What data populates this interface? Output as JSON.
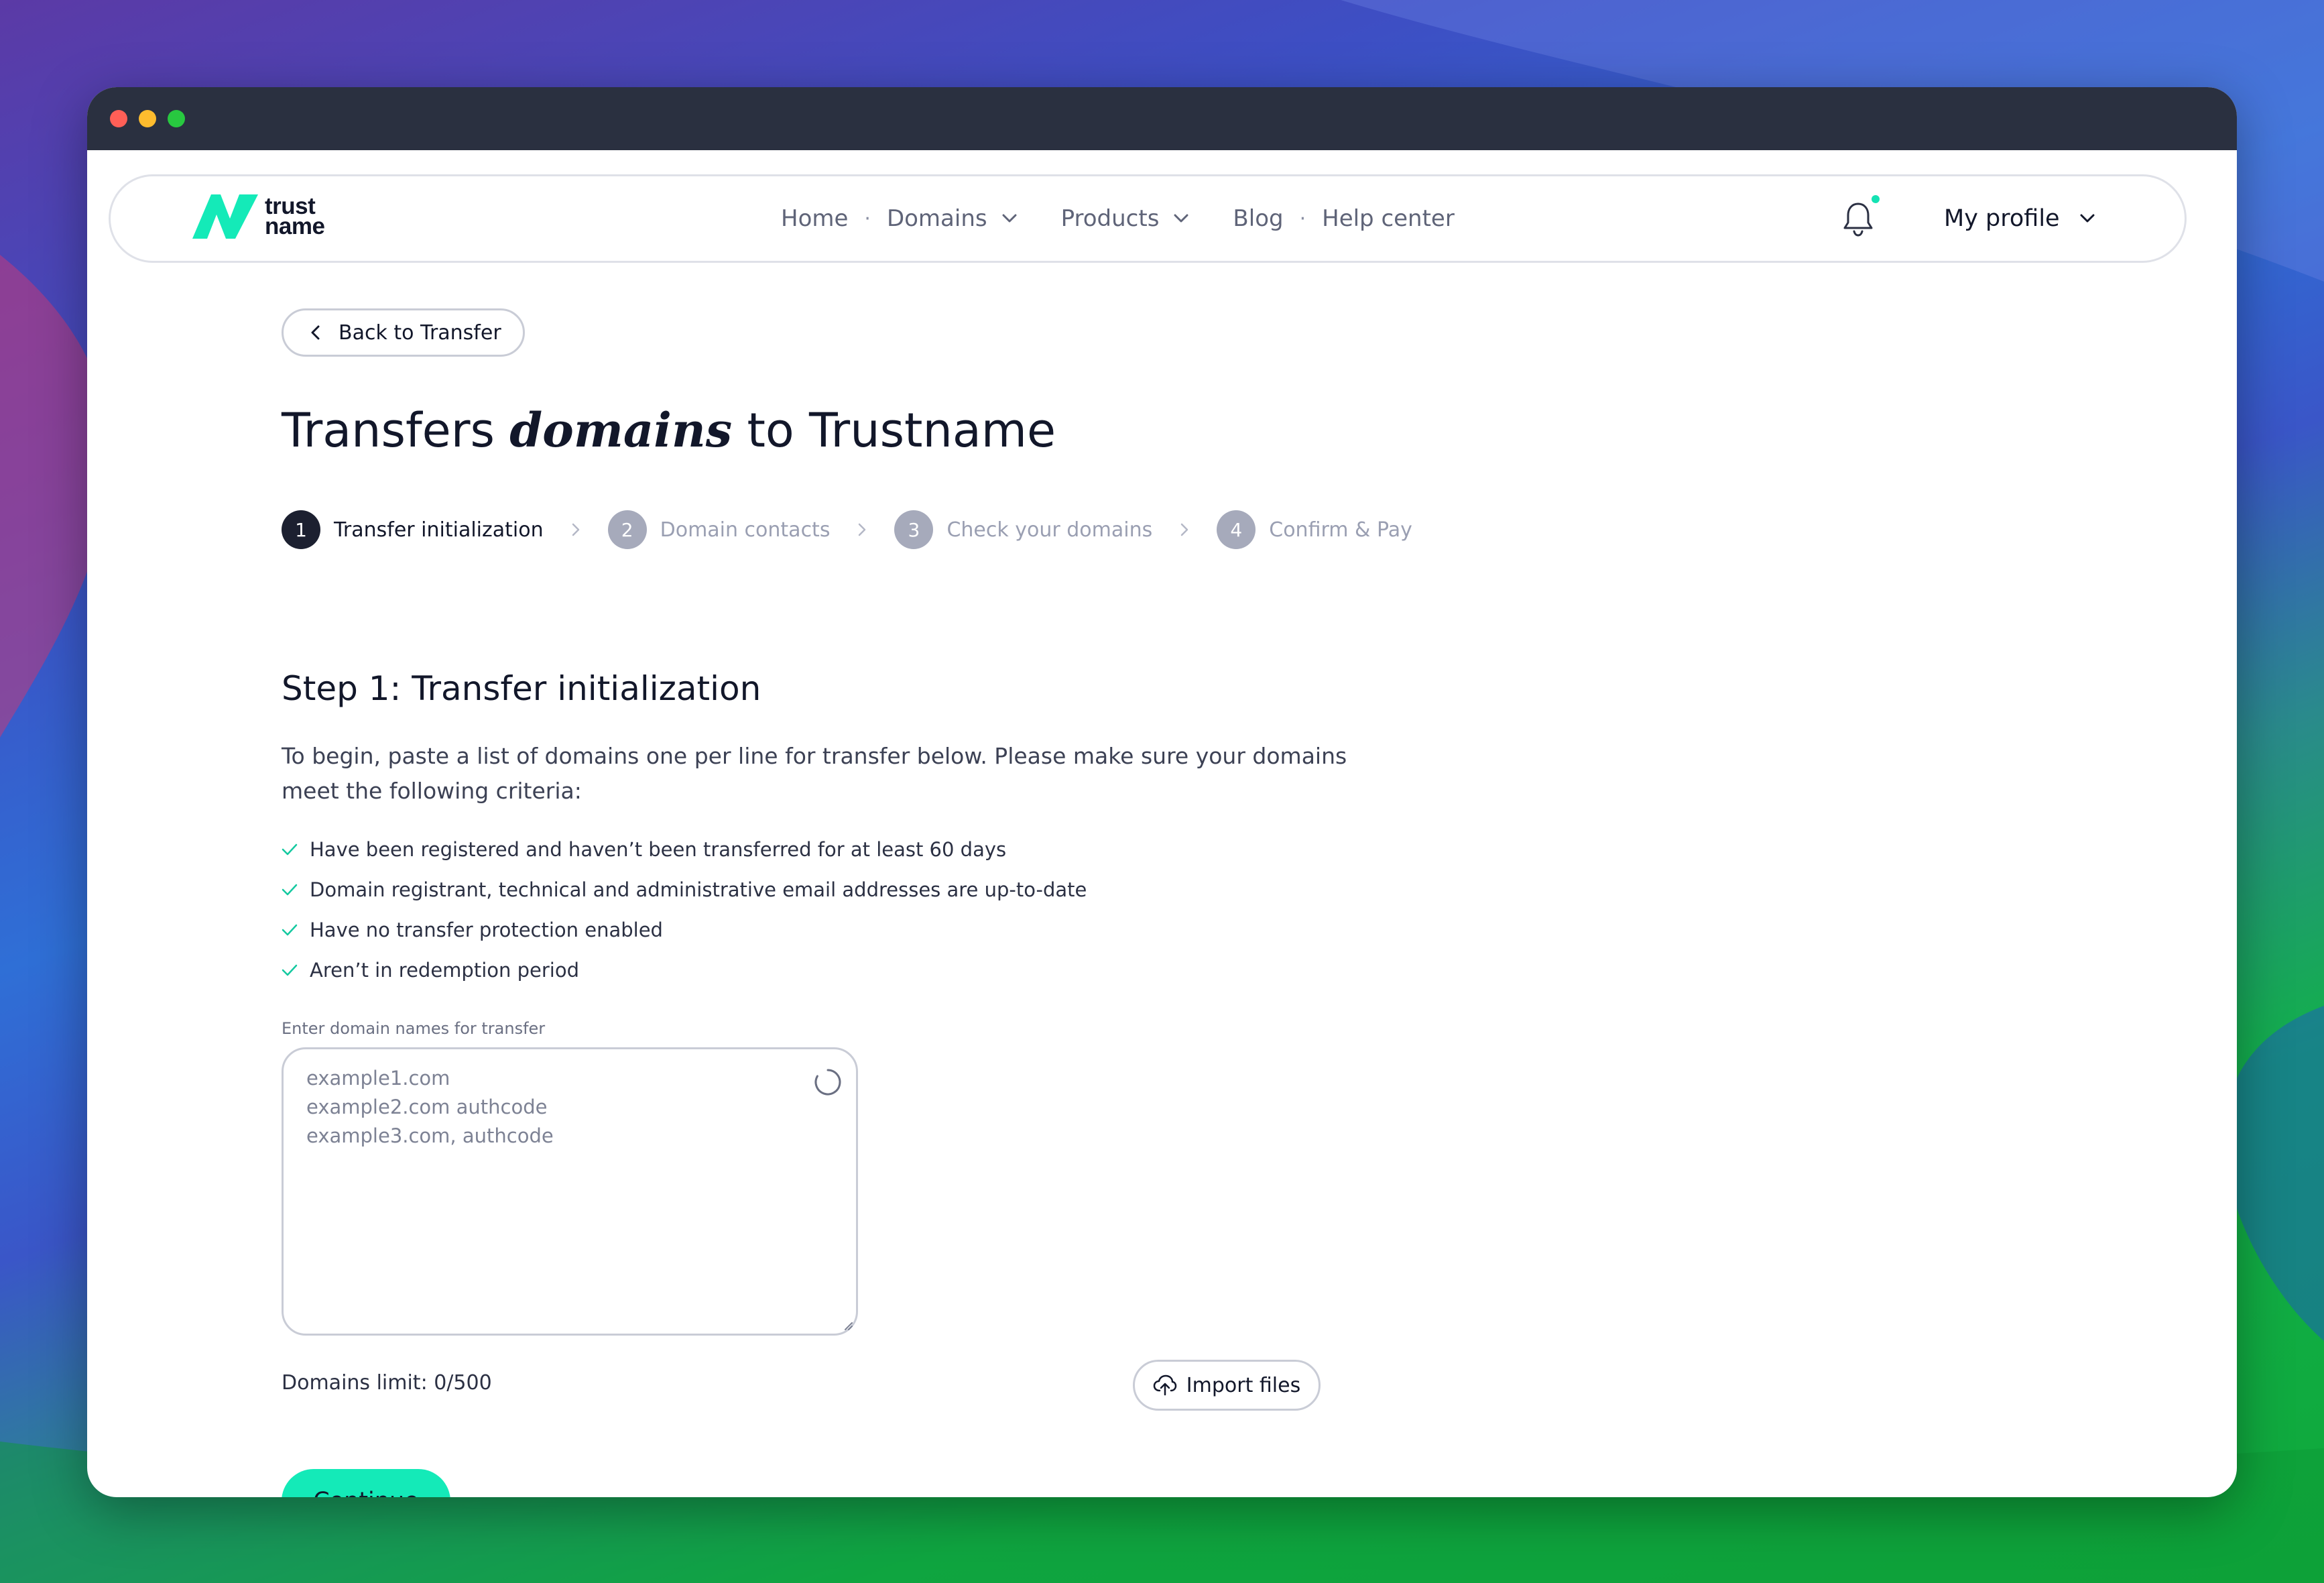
{
  "brand": {
    "logo_line1": "trust",
    "logo_line2": "name",
    "accent": "#14eab8",
    "dark": "#12172a"
  },
  "nav": {
    "items": [
      {
        "label": "Home"
      },
      {
        "label": "Domains"
      },
      {
        "label": "Products"
      },
      {
        "label": "Blog"
      },
      {
        "label": "Help center"
      }
    ],
    "separator": "·",
    "profile_label": "My profile"
  },
  "page": {
    "back_label": "Back to Transfer",
    "title_prefix": "Transfers",
    "title_emphasis": "domains",
    "title_suffix": "to Trustname"
  },
  "steps": [
    {
      "number": "1",
      "label": "Transfer initialization",
      "active": true
    },
    {
      "number": "2",
      "label": "Domain contacts",
      "active": false
    },
    {
      "number": "3",
      "label": "Check your domains",
      "active": false
    },
    {
      "number": "4",
      "label": "Confirm & Pay",
      "active": false
    }
  ],
  "content": {
    "heading": "Step 1: Transfer initialization",
    "intro": "To begin, paste a list of domains one per line for transfer below. Please make sure your domains meet the following criteria:",
    "criteria": [
      "Have been registered and haven’t been transferred for at least 60 days",
      "Domain registrant, technical and administrative email addresses are up-to-date",
      "Have no transfer protection enabled",
      "Aren’t in redemption period"
    ],
    "field_label": "Enter domain names for transfer",
    "placeholder_lines": [
      "example1.com",
      "example2.com authcode",
      "example3.com, authcode"
    ],
    "limit_text": "Domains limit: 0/500",
    "import_label": "Import files",
    "continue_label": "Continue"
  }
}
